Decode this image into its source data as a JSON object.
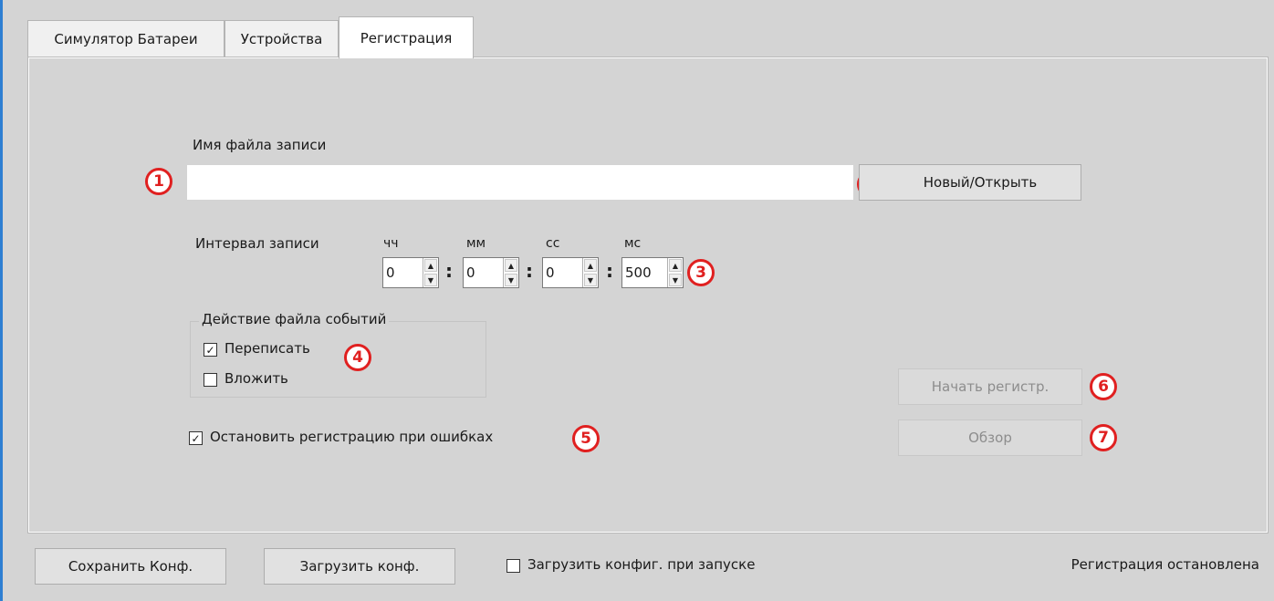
{
  "tabs": [
    "Симулятор Батареи",
    "Устройства",
    "Регистрация"
  ],
  "record": {
    "filename_label": "Имя файла записи",
    "filename_value": "",
    "new_open_button": "Новый/Открыть",
    "interval_label": "Интервал записи",
    "units": {
      "hh": "чч",
      "mm": "мм",
      "ss": "сс",
      "ms": "мс"
    },
    "values": {
      "hh": "0",
      "mm": "0",
      "ss": "0",
      "ms": "500"
    },
    "colon": ":"
  },
  "event_file": {
    "title": "Действие файла событий",
    "overwrite_label": "Переписать",
    "overwrite_checked": true,
    "append_label": "Вложить",
    "append_checked": false
  },
  "stop_on_errors": {
    "label": "Остановить регистрацию при ошибках",
    "checked": true
  },
  "actions": {
    "start": "Начать регистр.",
    "browse": "Обзор"
  },
  "bottom": {
    "save": "Сохранить Конф.",
    "load": "Загрузить конф.",
    "load_on_start_label": "Загрузить конфиг. при запуске",
    "load_on_start_checked": false,
    "status": "Регистрация остановлена"
  },
  "badges": [
    "1",
    "2",
    "3",
    "4",
    "5",
    "6",
    "7"
  ],
  "colors": {
    "badge": "#e02020",
    "accent_edge": "#2e7fd2"
  }
}
